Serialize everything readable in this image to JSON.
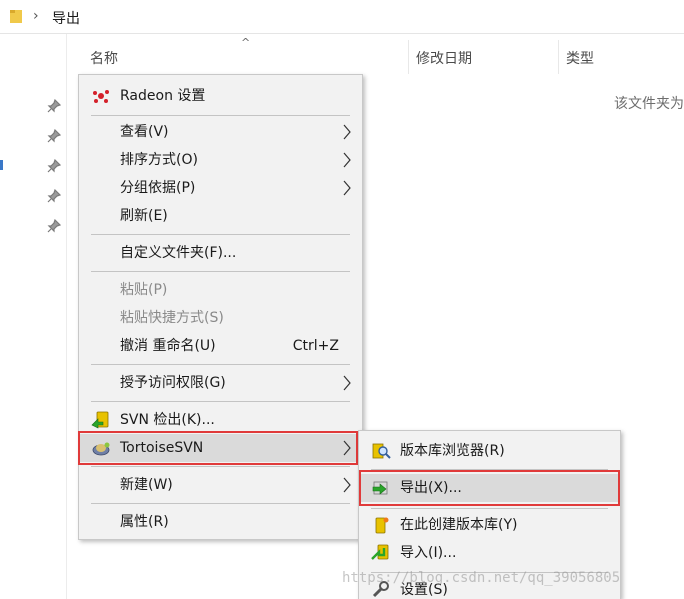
{
  "address": {
    "folder_icon": "folder-icon",
    "chevron": "›",
    "path": "导出"
  },
  "columns": {
    "name": "名称",
    "date_modified": "修改日期",
    "type": "类型",
    "sort_indicator": "^"
  },
  "empty_message": "该文件夹为",
  "context_menu": {
    "radeon": "Radeon 设置",
    "view": "查看(V)",
    "sort_by": "排序方式(O)",
    "group_by": "分组依据(P)",
    "refresh": "刷新(E)",
    "customize_folder": "自定义文件夹(F)...",
    "paste": "粘贴(P)",
    "paste_shortcut": "粘贴快捷方式(S)",
    "undo_rename": "撤消 重命名(U)",
    "undo_shortcut": "Ctrl+Z",
    "give_access": "授予访问权限(G)",
    "svn_checkout": "SVN 检出(K)...",
    "tortoise": "TortoiseSVN",
    "new": "新建(W)",
    "properties": "属性(R)"
  },
  "submenu": {
    "repo_browser": "版本库浏览器(R)",
    "export": "导出(X)...",
    "create_repo": "在此创建版本库(Y)",
    "import": "导入(I)...",
    "settings": "设置(S)"
  },
  "watermark": "https://blog.csdn.net/qq_39056805",
  "colors": {
    "menu_bg": "#f2f2f2",
    "highlight": "#dadada",
    "red_box": "#e03a3a"
  }
}
